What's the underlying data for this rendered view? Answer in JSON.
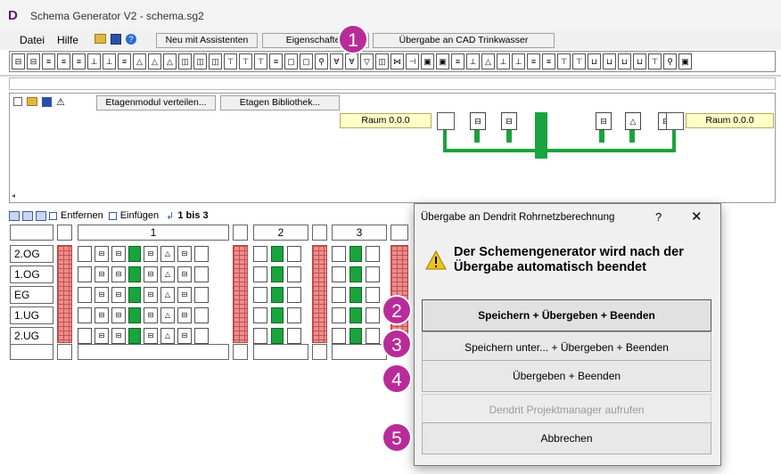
{
  "window": {
    "logo": "D",
    "title": "Schema Generator V2  -  schema.sg2"
  },
  "menu": {
    "datei": "Datei",
    "hilfe": "Hilfe"
  },
  "toolbar": {
    "neu_label": "Neu mit Assistenten",
    "eigenschaften_label": "Eigenschaften",
    "uebergabe_label": "Übergabe an CAD Trinkwasser"
  },
  "module_panel": {
    "verteilen_label": "Etagenmodul verteilen...",
    "bibliothek_label": "Etagen Bibliothek...",
    "raum_left": "Raum 0.0.0",
    "raum_right": "Raum 0.0.0"
  },
  "grid": {
    "entfernen_label": "Entfernen",
    "einfuegen_label": "Einfügen",
    "range_label": "1 bis 3",
    "columns": [
      "1",
      "2",
      "3"
    ],
    "floors": [
      "2.OG",
      "1.OG",
      "EG",
      "1.UG",
      "2.UG"
    ]
  },
  "dialog": {
    "title": "Übergabe an Dendrit Rohrnetzberechnung",
    "help": "?",
    "close": "✕",
    "message": "Der Schemengenerator wird nach der Übergabe automatisch beendet",
    "buttons": {
      "speichern": "Speichern + Übergeben + Beenden",
      "speichern_unter": "Speichern unter... + Übergeben + Beenden",
      "uebergeben": "Übergeben + Beenden",
      "projektmanager": "Dendrit Projektmanager aufrufen",
      "abbrechen": "Abbrechen"
    }
  },
  "badges": [
    "1",
    "2",
    "3",
    "4",
    "5"
  ],
  "colors": {
    "badge": "#b82c9a",
    "pipe": "#1aa43d",
    "brick": "#e98f8f",
    "raum_bg": "#ffffc8"
  }
}
